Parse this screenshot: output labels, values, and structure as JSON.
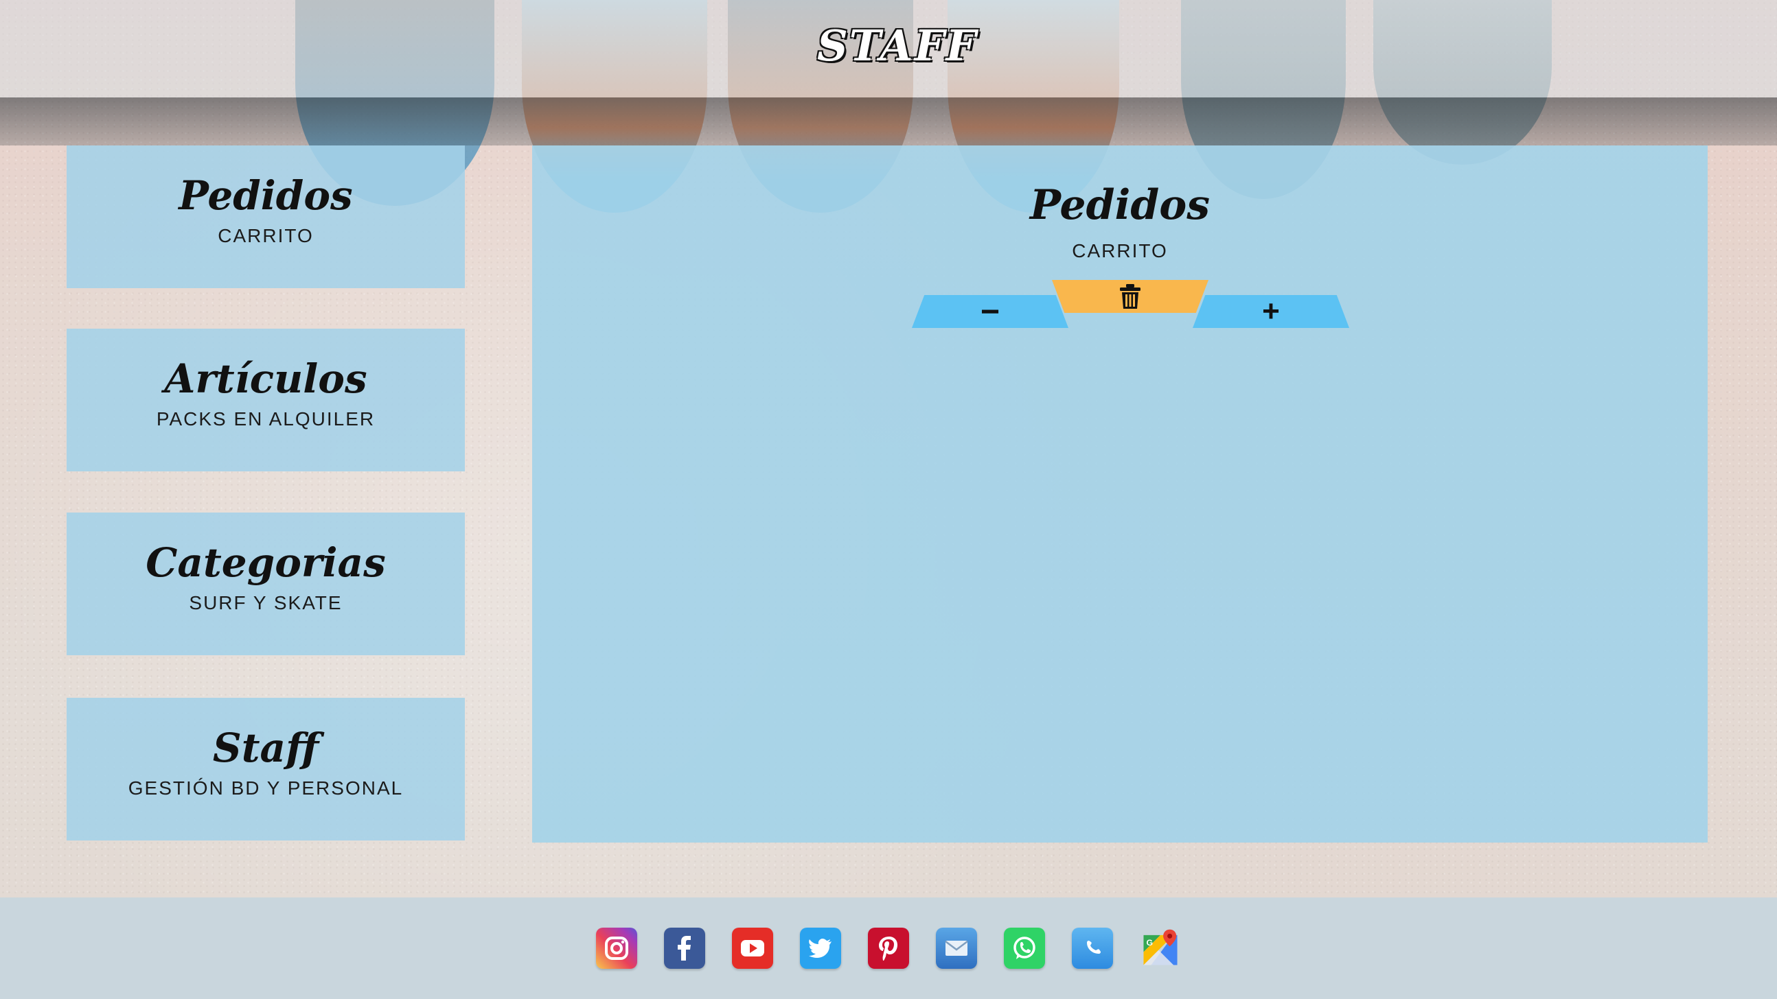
{
  "header": {
    "title": "STAFF"
  },
  "sidebar": {
    "items": [
      {
        "title": "Pedidos",
        "subtitle": "CARRITO"
      },
      {
        "title": "Artículos",
        "subtitle": "PACKS EN ALQUILER"
      },
      {
        "title": "Categorias",
        "subtitle": "SURF Y SKATE"
      },
      {
        "title": "Staff",
        "subtitle": "GESTIÓN BD Y PERSONAL"
      }
    ]
  },
  "main": {
    "title": "Pedidos",
    "subtitle": "CARRITO",
    "controls": {
      "minus_label": "−",
      "plus_label": "+",
      "delete_icon": "trash-icon"
    }
  },
  "footer": {
    "social": [
      {
        "icon": "instagram-icon"
      },
      {
        "icon": "facebook-icon"
      },
      {
        "icon": "youtube-icon"
      },
      {
        "icon": "twitter-icon"
      },
      {
        "icon": "pinterest-icon"
      },
      {
        "icon": "mail-icon"
      },
      {
        "icon": "whatsapp-icon"
      },
      {
        "icon": "phone-icon"
      },
      {
        "icon": "google-maps-icon"
      }
    ]
  },
  "colors": {
    "card_bg": "#a4d2e8",
    "button_blue": "#5cc2f3",
    "button_orange": "#f9b74d",
    "footer_bg": "#c9d6dd"
  }
}
